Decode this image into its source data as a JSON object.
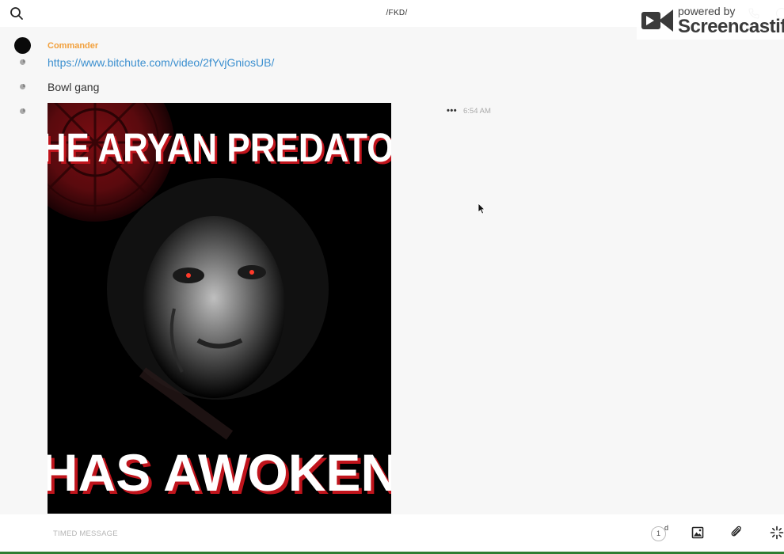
{
  "header": {
    "title": "/FKD/",
    "search_icon": "search-icon"
  },
  "watermark": {
    "powered_by": "powered by",
    "brand": "Screencastify"
  },
  "header_actions": {
    "call_icon": "phone-icon",
    "info_icon": "info-icon"
  },
  "conversation": {
    "sender": "Commander",
    "messages": [
      {
        "type": "link",
        "text": "https://www.bitchute.com/video/2fYvjGniosUB/"
      },
      {
        "type": "text",
        "text": "Bowl gang"
      },
      {
        "type": "image",
        "image_text_top": "THE ARYAN PREDATOR",
        "image_text_bottom": "HAS AWOKEN",
        "timestamp": "6:54 AM",
        "menu_label": "•••"
      }
    ]
  },
  "composer": {
    "placeholder": "TIMED MESSAGE",
    "timer_value": "1",
    "timer_unit": "d"
  },
  "colors": {
    "sender": "#f2a03c",
    "link": "#3b8fcf",
    "poster_text": "#ffffff",
    "poster_glow": "#c0141c",
    "bottom_bar": "#2e7d32"
  }
}
